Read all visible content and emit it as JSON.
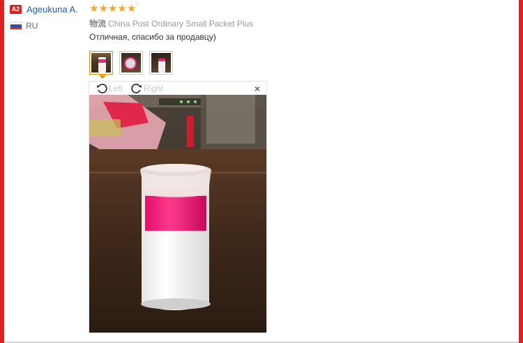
{
  "reviewer": {
    "badge": "A2",
    "name": "Ageukuna A.",
    "country": "RU",
    "flag_colors": [
      "#ffffff",
      "#2d4fb0",
      "#d52b1e"
    ]
  },
  "review": {
    "rating": 5,
    "stars": [
      "★",
      "★",
      "★",
      "★",
      "★"
    ],
    "rating_mark": "'",
    "shipping_label": "物流",
    "shipping_method": "China Post Ordinary Small Packet Plus",
    "comment": "Отличная, спасибо за продавцу)"
  },
  "photos": {
    "thumbnails": [
      "photo-1",
      "photo-2",
      "photo-3"
    ],
    "active_index": 0
  },
  "viewer": {
    "rotate_left_label": "Left",
    "rotate_right_label": "Right",
    "close_label": "×"
  },
  "colors": {
    "frame": "#e02020",
    "link": "#1e5fb3",
    "star": "#f5a623",
    "active_thumb": "#f08c00"
  }
}
